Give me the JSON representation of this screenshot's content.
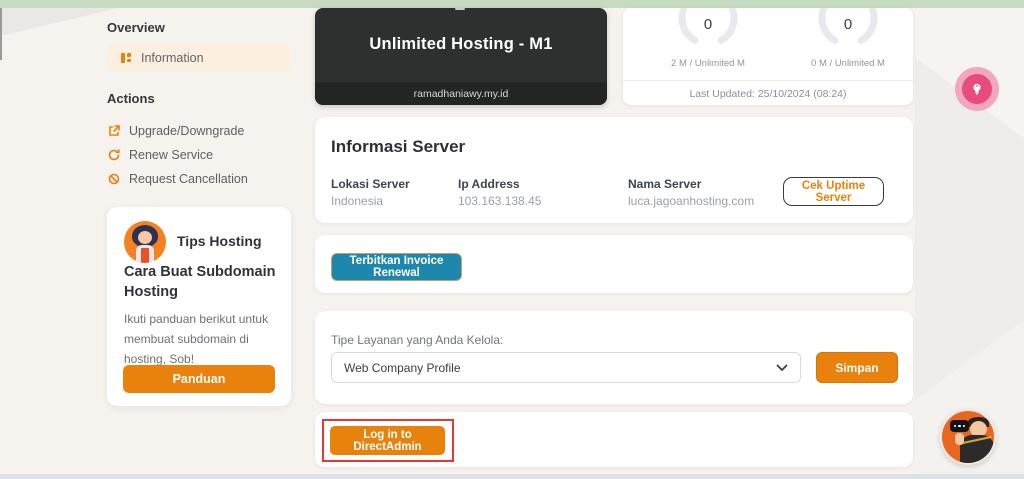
{
  "colors": {
    "accent_orange": "#e8820c",
    "invoice_blue": "#1d87ae",
    "annotation_red": "#e53935",
    "green_strip": "#c6dcc1",
    "pink_help_outer": "#f2a6bf",
    "pink_help_inner": "#e84b7d"
  },
  "sidebar": {
    "overview_heading": "Overview",
    "information_label": "Information",
    "actions_heading": "Actions",
    "action_items": [
      {
        "label": "Upgrade/Downgrade",
        "icon": "external-arrow-icon"
      },
      {
        "label": "Renew Service",
        "icon": "refresh-icon"
      },
      {
        "label": "Request Cancellation",
        "icon": "ban-icon"
      }
    ],
    "tips_card": {
      "title": "Tips Hosting",
      "heading": "Cara Buat Subdomain Hosting",
      "body": "Ikuti panduan berikut untuk membuat subdomain di hosting, Sob!",
      "button_label": "Panduan"
    }
  },
  "plan_card": {
    "title": "Unlimited Hosting - M1",
    "domain": "ramadhaniawy.my.id"
  },
  "usage_card": {
    "gauges": [
      {
        "value": "0",
        "label": "2 M / Unlimited M"
      },
      {
        "value": "0",
        "label": "0 M / Unlimited M"
      }
    ],
    "last_updated": "Last Updated: 25/10/2024 (08:24)"
  },
  "server_info": {
    "title": "Informasi Server",
    "fields": [
      {
        "label": "Lokasi Server",
        "value": "Indonesia"
      },
      {
        "label": "Ip Address",
        "value": "103.163.138.45"
      },
      {
        "label": "Nama Server",
        "value": "luca.jagoanhosting.com"
      }
    ],
    "uptime_button_label": "Cek Uptime Server"
  },
  "renewal": {
    "button_label": "Terbitkan Invoice Renewal"
  },
  "service_type": {
    "label": "Tipe Layanan yang Anda Kelola:",
    "selected_value": "Web Company Profile",
    "save_button_label": "Simpan"
  },
  "directadmin": {
    "button_label": "Log in to DirectAdmin"
  }
}
